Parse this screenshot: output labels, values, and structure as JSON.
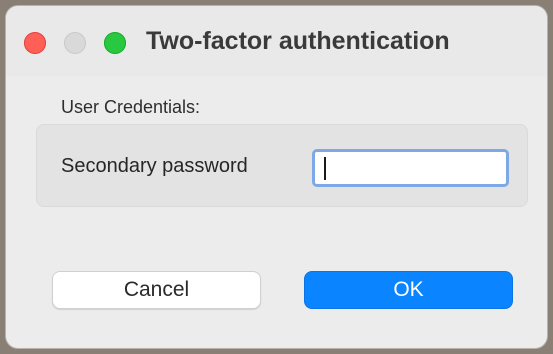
{
  "window": {
    "title": "Two-factor authentication"
  },
  "form": {
    "section_label": "User Credentials:",
    "fields": [
      {
        "label": "Secondary password",
        "value": "",
        "focused": true
      }
    ]
  },
  "buttons": {
    "cancel_label": "Cancel",
    "ok_label": "OK"
  },
  "colors": {
    "accent": "#0a84ff",
    "close": "#ff5f57",
    "minimize": "#d9d9d9",
    "zoom": "#28c840"
  },
  "icons": [
    "close-window-icon",
    "minimize-window-icon",
    "zoom-window-icon"
  ]
}
